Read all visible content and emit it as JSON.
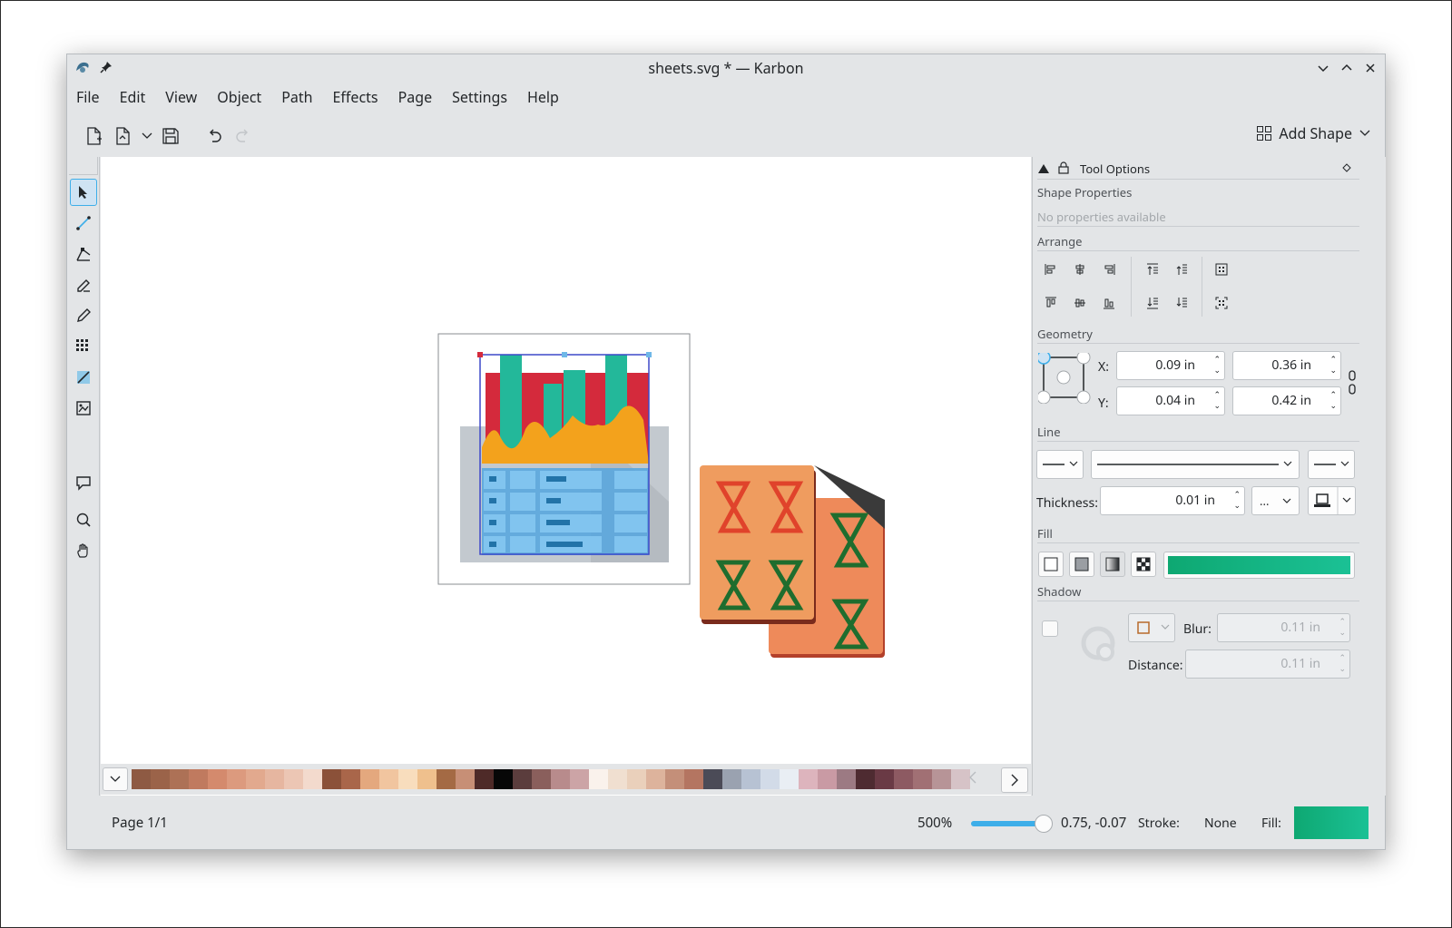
{
  "window": {
    "title": "sheets.svg * — Karbon"
  },
  "menu": [
    "File",
    "Edit",
    "View",
    "Object",
    "Path",
    "Effects",
    "Page",
    "Settings",
    "Help"
  ],
  "toolbar": {
    "add_shape": "Add Shape"
  },
  "dock": {
    "title": "Tool Options",
    "shape_properties": "Shape Properties",
    "no_properties": "No properties available",
    "arrange": "Arrange",
    "geometry": "Geometry",
    "x_label": "X:",
    "y_label": "Y:",
    "x_value": "0.09 in",
    "w_value": "0.36 in",
    "y_value": "0.04 in",
    "h_value": "0.42 in",
    "line": "Line",
    "thickness_label": "Thickness:",
    "thickness_value": "0.01 in",
    "dash_value": "...",
    "fill": "Fill",
    "shadow": "Shadow",
    "blur_label": "Blur:",
    "blur_value": "0.11 in",
    "distance_label": "Distance:",
    "distance_value": "0.11 in"
  },
  "status": {
    "page": "Page 1/1",
    "zoom": "500%",
    "coords": "0.75, -0.07",
    "stroke_label": "Stroke:",
    "stroke_value": "None",
    "fill_label": "Fill:"
  },
  "colors": {
    "accent": "#3daee9",
    "fill_gradient_start": "#0ea872",
    "fill_gradient_end": "#1bc195"
  },
  "palette": [
    "#8e5a43",
    "#9b6349",
    "#ad7156",
    "#c07a5f",
    "#d48a6d",
    "#dc9a7e",
    "#e2a98e",
    "#e6b6a0",
    "#ecc6b4",
    "#f3dacd",
    "#8b5139",
    "#a9664a",
    "#e4a87e",
    "#f1c59f",
    "#f8ddbd",
    "#efc08d",
    "#a46a44",
    "#c78f76",
    "#4e2a28",
    "#070707",
    "#5b3d3d",
    "#8a5f5c",
    "#b88b8c",
    "#cca4a6",
    "#faf2ec",
    "#f0dfd0",
    "#ead0bb",
    "#ddb39c",
    "#c48f79",
    "#b47561",
    "#4b4b57",
    "#9aa2b0",
    "#b7c2d3",
    "#d2dbe8",
    "#e9eef4",
    "#ddb4bd",
    "#c99aa4",
    "#9c7a83",
    "#4e2b31",
    "#6a3a45",
    "#8d5a62",
    "#a17074",
    "#b79497",
    "#d6c3c7"
  ]
}
